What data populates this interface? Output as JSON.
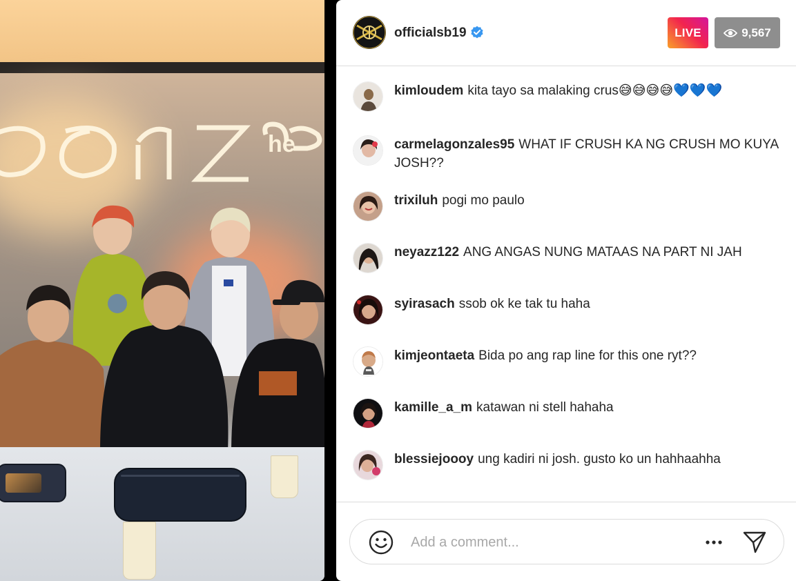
{
  "header": {
    "username": "officialsb19",
    "verified": true,
    "live_label": "LIVE",
    "viewer_count": "9,567",
    "viewer_icon": "eye-icon"
  },
  "video": {
    "sign_text": "the ZONE"
  },
  "comments": [
    {
      "user": "kimloudem",
      "text": "kita tayo sa malaking crus😅😅😅😅💙💙💙"
    },
    {
      "user": "carmelagonzales95",
      "text": "WHAT IF CRUSH KA NG CRUSH MO KUYA JOSH??"
    },
    {
      "user": "trixiluh",
      "text": "pogi mo paulo"
    },
    {
      "user": "neyazz122",
      "text": "ANG ANGAS NUNG MATAAS NA PART NI JAH"
    },
    {
      "user": "syirasach",
      "text": "ssob ok ke tak tu haha"
    },
    {
      "user": "kimjeontaeta",
      "text": "Bida po ang rap line for this one ryt??"
    },
    {
      "user": "kamille_a_m",
      "text": "katawan ni stell hahaha"
    },
    {
      "user": "blessiejoooy",
      "text": "ung kadiri ni josh. gusto ko un hahhaahha"
    }
  ],
  "composer": {
    "placeholder": "Add a comment...",
    "emoji_icon": "smiley-icon",
    "more_icon": "more-dots-icon",
    "send_icon": "send-icon"
  },
  "colors": {
    "live_gradient": [
      "#f9a02a",
      "#f2244e",
      "#d3169c"
    ],
    "viewer_badge": "#8e8e8e",
    "verified_blue": "#3897f0",
    "text": "#262626",
    "placeholder": "#a8a8a8"
  }
}
